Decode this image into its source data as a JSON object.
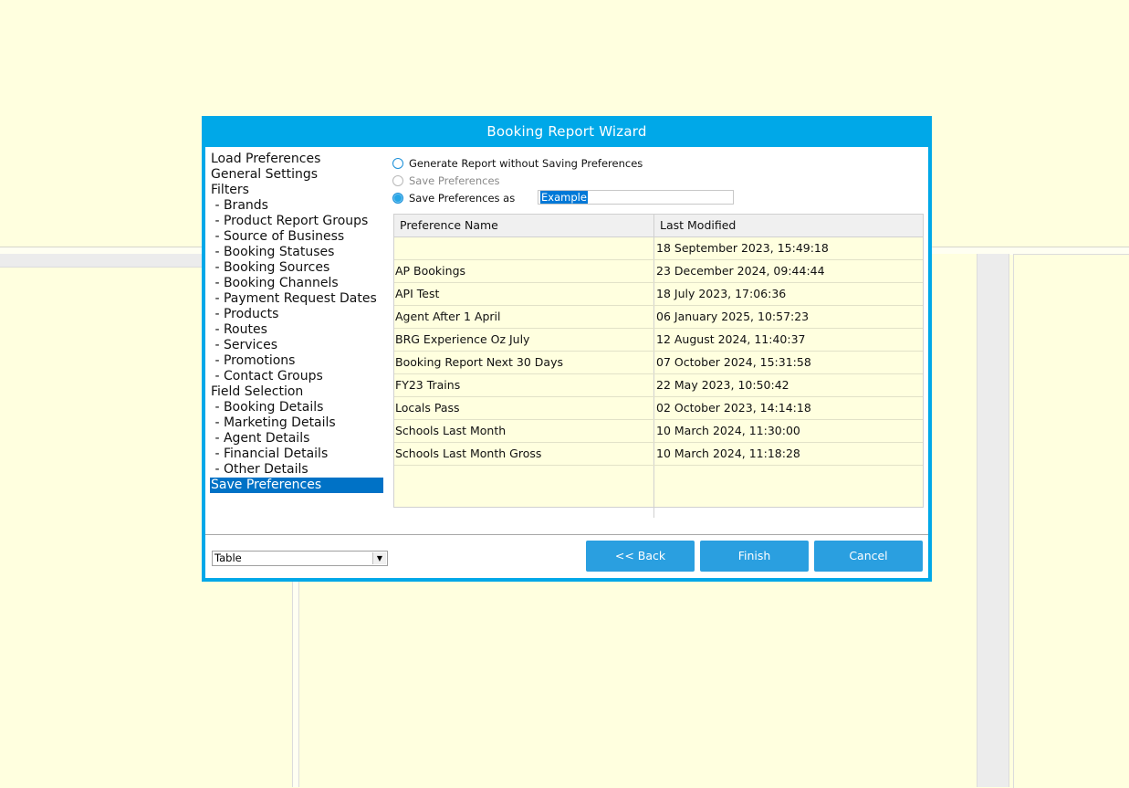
{
  "dialog": {
    "title": "Booking Report Wizard"
  },
  "nav": {
    "items": [
      {
        "label": "Load Preferences"
      },
      {
        "label": "General Settings"
      },
      {
        "label": "Filters"
      },
      {
        "label": " - Brands"
      },
      {
        "label": " - Product Report Groups"
      },
      {
        "label": " - Source of Business"
      },
      {
        "label": " - Booking Statuses"
      },
      {
        "label": " - Booking Sources"
      },
      {
        "label": " - Booking Channels"
      },
      {
        "label": " - Payment Request Dates"
      },
      {
        "label": " - Products"
      },
      {
        "label": " - Routes"
      },
      {
        "label": " - Services"
      },
      {
        "label": " - Promotions"
      },
      {
        "label": " - Contact Groups"
      },
      {
        "label": "Field Selection"
      },
      {
        "label": " - Booking Details"
      },
      {
        "label": " - Marketing Details"
      },
      {
        "label": " - Agent Details"
      },
      {
        "label": " - Financial Details"
      },
      {
        "label": " - Other Details"
      },
      {
        "label": "Save Preferences"
      }
    ],
    "active_index": 21
  },
  "options": {
    "generate_label": "Generate Report without Saving Preferences",
    "save_label": "Save Preferences",
    "save_as_label": "Save Preferences as",
    "selected": "save_as",
    "save_as_value": "Example"
  },
  "table": {
    "headers": [
      "Preference Name",
      "Last Modified"
    ],
    "rows": [
      [
        "",
        "18 September 2023, 15:49:18"
      ],
      [
        "AP Bookings",
        "23 December 2024, 09:44:44"
      ],
      [
        "API Test",
        "18 July 2023, 17:06:36"
      ],
      [
        "Agent After 1 April",
        "06 January 2025, 10:57:23"
      ],
      [
        "BRG Experience Oz July",
        "12 August 2024, 11:40:37"
      ],
      [
        "Booking Report Next 30 Days",
        "07 October 2024, 15:31:58"
      ],
      [
        "FY23 Trains",
        "22 May 2023, 10:50:42"
      ],
      [
        "Locals Pass",
        "02 October 2023, 14:14:18"
      ],
      [
        "Schools Last Month",
        "10 March 2024, 11:30:00"
      ],
      [
        "Schools Last Month Gross",
        "10 March 2024, 11:18:28"
      ]
    ]
  },
  "footer": {
    "output_format": "Table",
    "back_label": "<< Back",
    "finish_label": "Finish",
    "cancel_label": "Cancel"
  },
  "colors": {
    "accent": "#00a8e8",
    "button": "#2a9fe0",
    "selection": "#0072c6",
    "background": "#ffffdf"
  }
}
